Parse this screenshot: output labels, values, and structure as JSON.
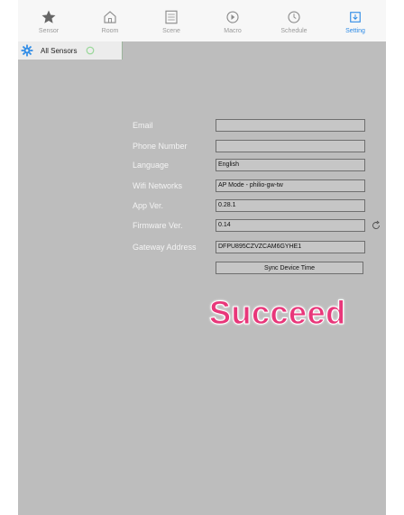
{
  "tabs": [
    {
      "label": "Sensor",
      "icon": "star-icon",
      "active": false
    },
    {
      "label": "Room",
      "icon": "home-icon",
      "active": false
    },
    {
      "label": "Scene",
      "icon": "scene-icon",
      "active": false
    },
    {
      "label": "Macro",
      "icon": "macro-icon",
      "active": false
    },
    {
      "label": "Schedule",
      "icon": "clock-icon",
      "active": false
    },
    {
      "label": "Setting",
      "icon": "setting-icon",
      "active": true
    }
  ],
  "sensor_bar": {
    "title": "All Sensors"
  },
  "form": {
    "email": {
      "label": "Email",
      "value": ""
    },
    "phone": {
      "label": "Phone Number",
      "value": ""
    },
    "language": {
      "label": "Language",
      "value": "English"
    },
    "wifi": {
      "label": "Wifi Networks",
      "value": "AP Mode - philio-gw-tw"
    },
    "app_ver": {
      "label": "App Ver.",
      "value": "0.28.1"
    },
    "firmware_ver": {
      "label": "Firmware Ver.",
      "value": "0.14"
    },
    "gateway": {
      "label": "Gateway Address",
      "value": "DFPU895CZVZCAM6GYHE1"
    },
    "sync_button": "Sync Device Time"
  },
  "overlay_message": "Succeed",
  "colors": {
    "accent": "#2e8be6",
    "overlay": "#e8377a",
    "background": "#bdbdbd"
  }
}
